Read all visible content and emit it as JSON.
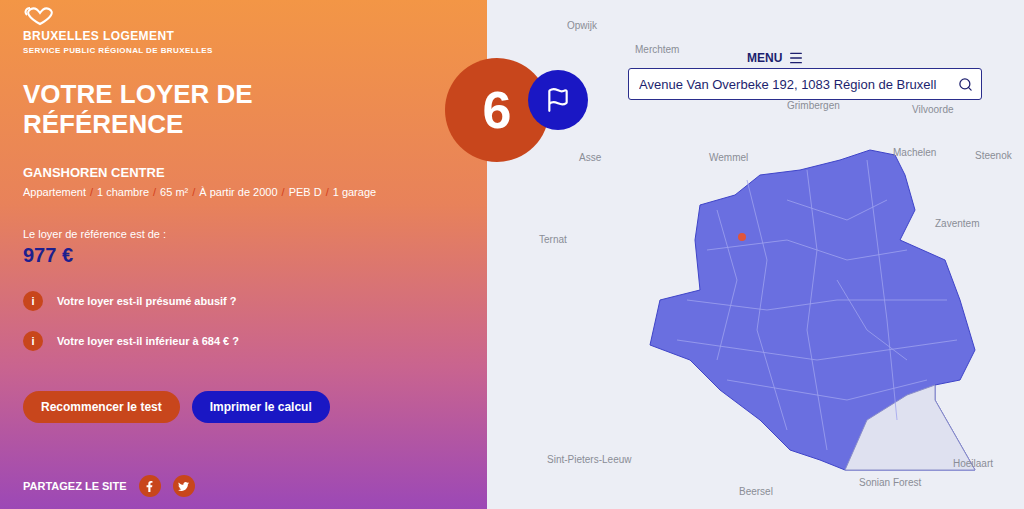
{
  "logo": {
    "title": "BRUXELLES LOGEMENT",
    "subtitle": "SERVICE PUBLIC RÉGIONAL DE BRUXELLES"
  },
  "heading": "VOTRE LOYER DE RÉFÉRENCE",
  "location": "GANSHOREN CENTRE",
  "separator": "/",
  "details": [
    "Appartement",
    "1 chambre",
    "65 m²",
    "À partir de 2000",
    "PEB D",
    "1 garage"
  ],
  "reference": {
    "label": "Le loyer de référence est de :",
    "amount": "977 €"
  },
  "questions": [
    {
      "icon": "i",
      "text": "Votre loyer est-il présumé abusif ?"
    },
    {
      "icon": "i",
      "text": "Votre loyer est-il inférieur à 684 € ?"
    }
  ],
  "buttons": [
    {
      "label": "Recommencer le test",
      "kind": "primary"
    },
    {
      "label": "Imprimer le calcul",
      "kind": "secondary"
    }
  ],
  "share": {
    "label": "PARTAGEZ LE SITE"
  },
  "badge": {
    "value": "6"
  },
  "menu": {
    "label": "MENU"
  },
  "search": {
    "value": "Avenue Van Overbeke 192, 1083 Région de Bruxell"
  },
  "map": {
    "labels": [
      "Opwijk",
      "Merchtem",
      "Grimbergen",
      "Vilvoorde",
      "Machelen",
      "Steenok",
      "Zaventem",
      "Asse",
      "Wemmel",
      "Ternat",
      "Sint-Pieters-Leeuw",
      "Beersel",
      "Hoeilaart",
      "Sonian Forest"
    ]
  }
}
